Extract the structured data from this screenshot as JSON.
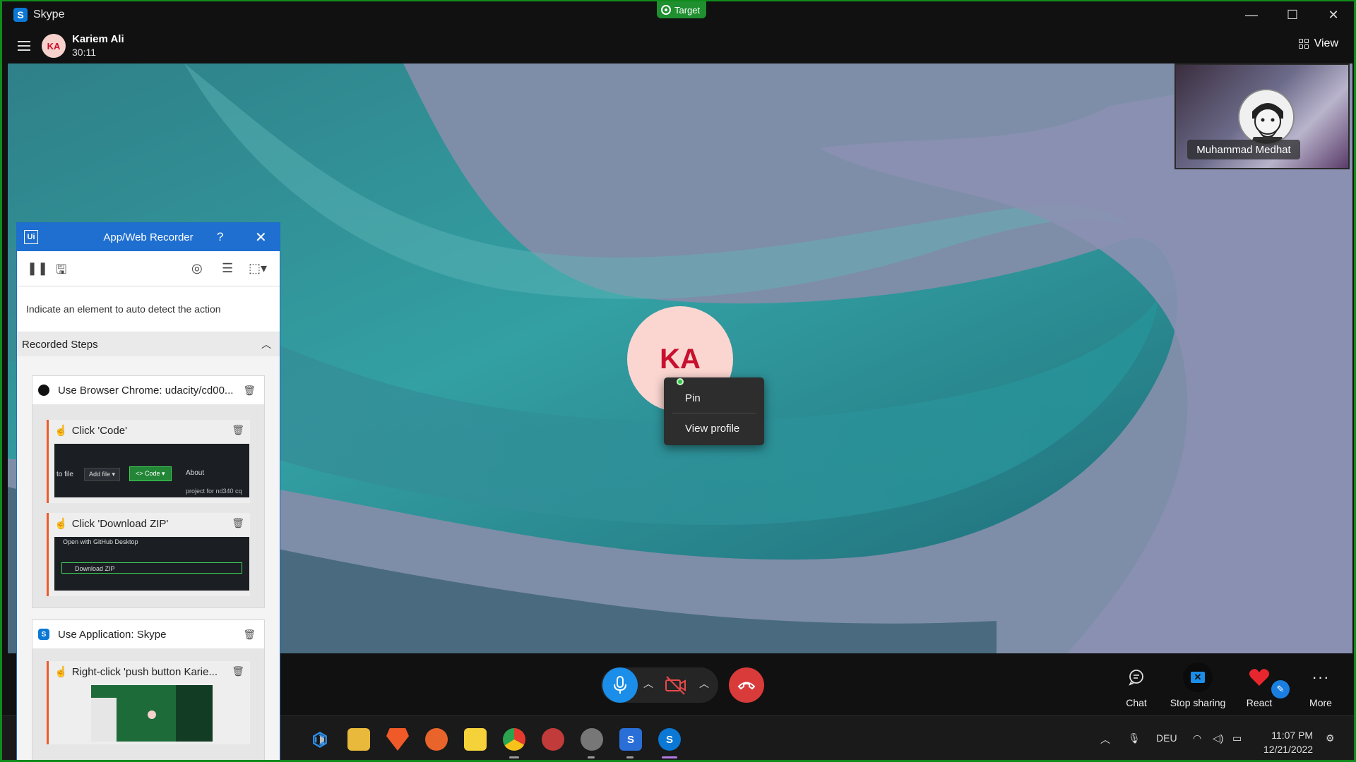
{
  "window": {
    "app_name": "Skype",
    "minimize": "—",
    "maximize": "☐",
    "close": "✕"
  },
  "target_badge": "Target",
  "call": {
    "caller_initials": "KA",
    "caller_name": "Kariem Ali",
    "duration": "30:11",
    "view_label": "View"
  },
  "pip": {
    "participant_name": "Muhammad Medhat"
  },
  "stage": {
    "avatar_initials": "KA"
  },
  "context_menu": {
    "items": [
      "Pin",
      "View profile"
    ]
  },
  "controls": {
    "chat": "Chat",
    "stop_sharing": "Stop sharing",
    "react": "React",
    "more": "More"
  },
  "taskbar": {
    "language": "DEU",
    "time": "11:07 PM",
    "date": "12/21/2022"
  },
  "recorder": {
    "title": "App/Web Recorder",
    "help": "?",
    "hint": "Indicate an element to auto detect the action",
    "steps_header": "Recorded Steps",
    "groups": [
      {
        "title": "Use Browser Chrome: udacity/cd00...",
        "steps": [
          "Click 'Code'",
          "Click 'Download ZIP'"
        ]
      },
      {
        "title": "Use Application: Skype",
        "steps": [
          "Right-click 'push button Karie..."
        ]
      }
    ],
    "thumb1": {
      "to_file": "to file",
      "add_file": "Add file ▾",
      "code": "<> Code ▾",
      "about": "About",
      "desc": "project for nd340 cq"
    },
    "thumb2": {
      "open_desktop": "Open with GitHub Desktop",
      "download_zip": "Download ZIP"
    }
  },
  "colors": {
    "accent_blue": "#1a8ee8",
    "hangup_red": "#d93b3b",
    "recorder_blue": "#1e6fd0",
    "uipath_green": "#1f8f2f",
    "step_orange": "#f05a28"
  }
}
